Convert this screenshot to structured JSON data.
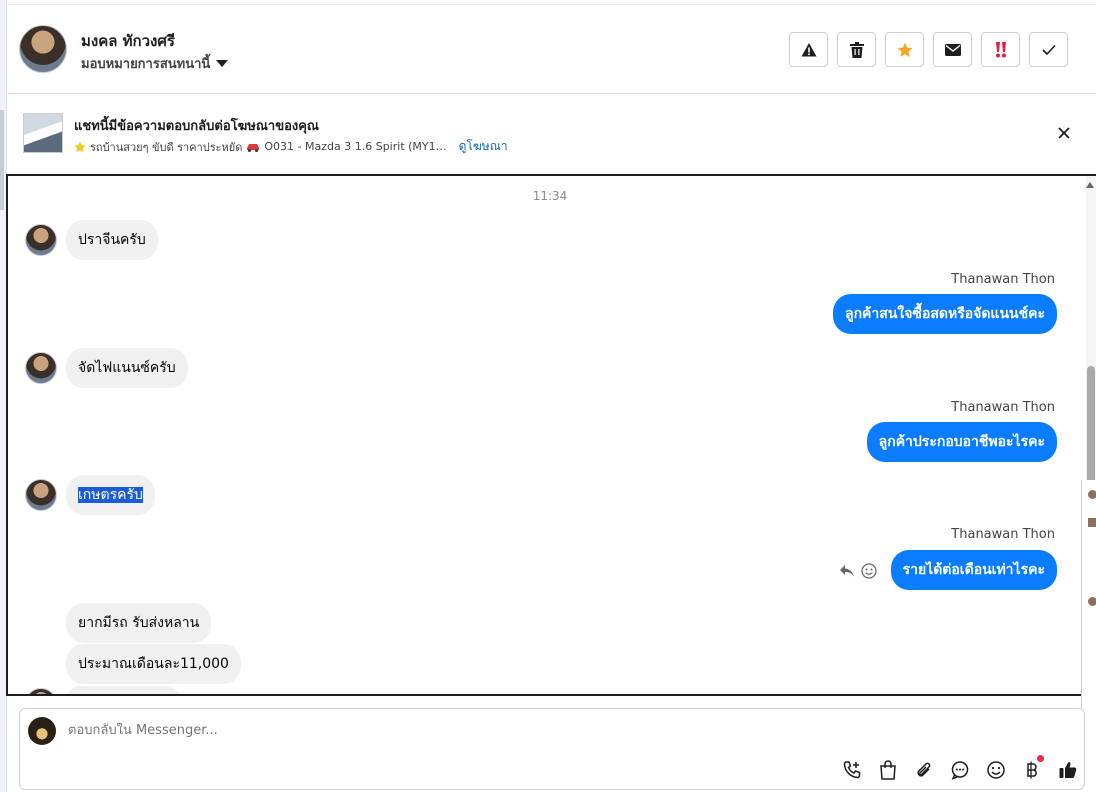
{
  "header": {
    "contact_name": "มงคล ทักวงศรี",
    "assign_label": "มอบหมายการสนทนานี้",
    "actions": [
      "report-icon",
      "trash-icon",
      "star-icon",
      "mail-icon",
      "urgent-icon",
      "check-icon"
    ],
    "colors": {
      "star": "#f5a623",
      "urgent": "#e41e3f"
    }
  },
  "banner": {
    "title": "แชทนี้มีข้อความตอบกลับต่อโฆษณาของคุณ",
    "ad_text": "รถบ้านสวยๆ ขับดี ราคาประหยัด",
    "car_text": "O031 - Mazda 3 1.6 Spirit (MY1…",
    "link": "ดูโฆษณา"
  },
  "chat": {
    "time": "11:34",
    "messages": [
      {
        "dir": "in",
        "text": "ปราจีนครับ"
      },
      {
        "dir": "out",
        "sender": "Thanawan Thon",
        "text": "ลูกค้าสนใจซื้อสดหรือจัดแนนช์คะ"
      },
      {
        "dir": "in",
        "text": "จัดไฟแนนซ์ครับ"
      },
      {
        "dir": "out",
        "sender": "Thanawan Thon",
        "text": "ลูกค้าประกอบอาชีพอะไรคะ"
      },
      {
        "dir": "in",
        "text": "เกษตรครับ",
        "selected": true
      },
      {
        "dir": "out",
        "sender": "Thanawan Thon",
        "text": "รายได้ต่อเดือนเท่าไรคะ"
      },
      {
        "dir": "in",
        "text": "ยากมีรถ รับส่งหลาน"
      },
      {
        "dir": "in",
        "text": "ประมาณเดือนละ11,000"
      }
    ]
  },
  "composer": {
    "placeholder": "ตอบกลับใน Messenger...",
    "tools": [
      "call-add-icon",
      "shopping-bag-icon",
      "attachment-icon",
      "chat-bubble-icon",
      "emoji-icon",
      "baht-icon",
      "thumbs-up-icon"
    ]
  },
  "colors": {
    "accent": "#0a7cff",
    "selection": "#1a5bd6",
    "incoming_bg": "#f0f0f0"
  }
}
